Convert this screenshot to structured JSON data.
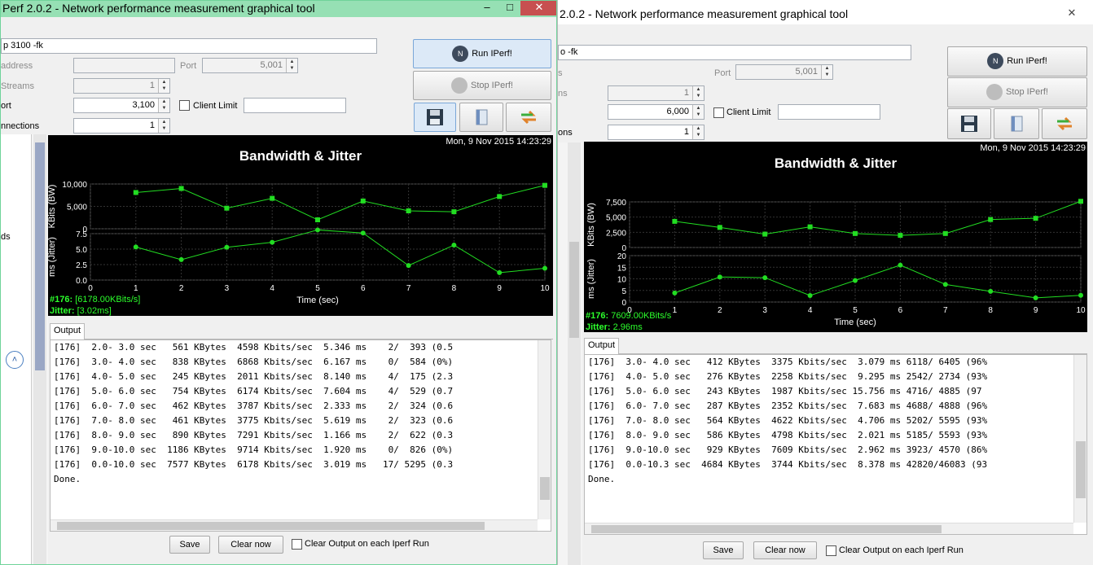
{
  "left": {
    "title": "Perf 2.0.2 - Network performance measurement graphical tool",
    "cmd": "p 3100 -fk",
    "lbl_address": "address",
    "lbl_port": "Port",
    "port": "5,001",
    "lbl_streams": "Streams",
    "streams": "1",
    "lbl_port2": "ort",
    "listen_port": "3,100",
    "client_limit": "Client Limit",
    "lbl_conn": "nnections",
    "connections": "1",
    "side_text": "ds",
    "run": "Run IPerf!",
    "stop": "Stop IPerf!",
    "graph_date": "Mon, 9 Nov 2015 14:23:29",
    "graph_title": "Bandwidth & Jitter",
    "status_id": "#176:",
    "status_bw": "[6178.00KBits/s]",
    "status_jit_label": "Jitter:",
    "status_jit": "[3.02ms]",
    "tab": "Output",
    "lines": [
      "[176]  2.0- 3.0 sec   561 KBytes  4598 Kbits/sec  5.346 ms    2/  393 (0.5",
      "[176]  3.0- 4.0 sec   838 KBytes  6868 Kbits/sec  6.167 ms    0/  584 (0%)",
      "[176]  4.0- 5.0 sec   245 KBytes  2011 Kbits/sec  8.140 ms    4/  175 (2.3",
      "[176]  5.0- 6.0 sec   754 KBytes  6174 Kbits/sec  7.604 ms    4/  529 (0.7",
      "[176]  6.0- 7.0 sec   462 KBytes  3787 Kbits/sec  2.333 ms    2/  324 (0.6",
      "[176]  7.0- 8.0 sec   461 KBytes  3775 Kbits/sec  5.619 ms    2/  323 (0.6",
      "[176]  8.0- 9.0 sec   890 KBytes  7291 Kbits/sec  1.166 ms    2/  622 (0.3",
      "[176]  9.0-10.0 sec  1186 KBytes  9714 Kbits/sec  1.920 ms    0/  826 (0%)",
      "[176]  0.0-10.0 sec  7577 KBytes  6178 Kbits/sec  3.019 ms   17/ 5295 (0.3",
      "Done."
    ],
    "save": "Save",
    "clear": "Clear now",
    "clear_each": "Clear Output on each Iperf Run"
  },
  "right": {
    "title": "2.0.2 - Network performance measurement graphical tool",
    "cmd": "o -fk",
    "lbl_port": "Port",
    "port": "5,001",
    "frag1": "s",
    "frag2": "ns",
    "streams": "1",
    "listen_port": "6,000",
    "client_limit": "Client Limit",
    "frag3": "ons",
    "connections": "1",
    "run": "Run IPerf!",
    "stop": "Stop IPerf!",
    "graph_date": "Mon, 9 Nov 2015 14:23:29",
    "graph_title": "Bandwidth & Jitter",
    "status_id": "#176:",
    "status_bw": "7609.00KBits/s",
    "status_jit_label": "Jitter:",
    "status_jit": "2.96ms",
    "tab": "Output",
    "lines": [
      "[176]  3.0- 4.0 sec   412 KBytes  3375 Kbits/sec  3.079 ms 6118/ 6405 (96%",
      "[176]  4.0- 5.0 sec   276 KBytes  2258 Kbits/sec  9.295 ms 2542/ 2734 (93%",
      "[176]  5.0- 6.0 sec   243 KBytes  1987 Kbits/sec 15.756 ms 4716/ 4885 (97",
      "[176]  6.0- 7.0 sec   287 KBytes  2352 Kbits/sec  7.683 ms 4688/ 4888 (96%",
      "[176]  7.0- 8.0 sec   564 KBytes  4622 Kbits/sec  4.706 ms 5202/ 5595 (93%",
      "[176]  8.0- 9.0 sec   586 KBytes  4798 Kbits/sec  2.021 ms 5185/ 5593 (93%",
      "[176]  9.0-10.0 sec   929 KBytes  7609 Kbits/sec  2.962 ms 3923/ 4570 (86%",
      "[176]  0.0-10.3 sec  4684 KBytes  3744 Kbits/sec  8.378 ms 42820/46083 (93",
      "Done."
    ],
    "save": "Save",
    "clear": "Clear now",
    "clear_each": "Clear Output on each Iperf Run"
  },
  "chart_data": [
    {
      "type": "line",
      "title": "Bandwidth & Jitter",
      "xlabel": "Time (sec)",
      "x": [
        1,
        2,
        3,
        4,
        5,
        6,
        7,
        8,
        9,
        10
      ],
      "bw": {
        "ylabel": "KBits (BW)",
        "values": [
          8100,
          9000,
          4600,
          6800,
          2000,
          6200,
          4000,
          3800,
          7200,
          9700
        ],
        "ylim": [
          0,
          10000
        ],
        "ticks": [
          "10,000",
          "5,000",
          "0"
        ],
        "tickvals": [
          10000,
          5000,
          0
        ]
      },
      "jitter": {
        "ylabel": "ms (Jitter)",
        "values": [
          5.35,
          3.3,
          5.3,
          6.1,
          8.1,
          7.6,
          2.35,
          5.65,
          1.2,
          1.9
        ],
        "ylim": [
          0,
          7.5
        ],
        "ticks": [
          "7.5",
          "5.0",
          "2.5",
          "0.0"
        ],
        "tickvals": [
          7.5,
          5,
          2.5,
          0
        ]
      },
      "color": "#22dd22"
    },
    {
      "type": "line",
      "title": "Bandwidth & Jitter",
      "xlabel": "Time (sec)",
      "x": [
        1,
        2,
        3,
        4,
        5,
        6,
        7,
        8,
        9,
        10
      ],
      "bw": {
        "ylabel": "KBits (BW)",
        "values": [
          4300,
          3300,
          2200,
          3400,
          2300,
          2000,
          2300,
          4600,
          4800,
          7600
        ],
        "ylim": [
          0,
          7500
        ],
        "ticks": [
          "7,500",
          "5,000",
          "2,500",
          "0"
        ],
        "tickvals": [
          7500,
          5000,
          2500,
          0
        ]
      },
      "jitter": {
        "ylabel": "ms (Jitter)",
        "values": [
          3.9,
          10.8,
          10.5,
          2.8,
          9.3,
          15.9,
          7.6,
          4.6,
          1.8,
          2.9
        ],
        "ylim": [
          0,
          20
        ],
        "ticks": [
          "20",
          "15",
          "10",
          "5",
          "0"
        ],
        "tickvals": [
          20,
          15,
          10,
          5,
          0
        ]
      },
      "color": "#22dd22"
    }
  ]
}
